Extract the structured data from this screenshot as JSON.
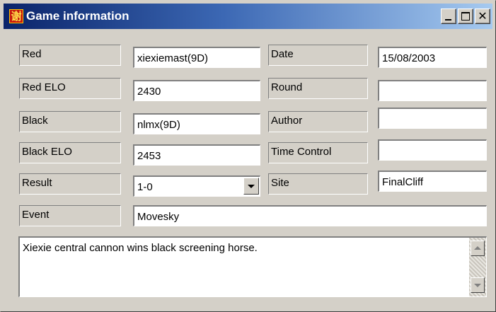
{
  "window": {
    "title": "Game information",
    "icon_char": "谢",
    "icon": "app-icon",
    "controls": [
      "minimize-icon",
      "maximize-icon",
      "close-icon"
    ],
    "close_glyph": "✕",
    "colors": {
      "titlebar_start": "#0a246a",
      "titlebar_end": "#a6caf0",
      "face": "#d4d0c8",
      "icon_bg": "#c8180f"
    }
  },
  "fields": {
    "red": {
      "label": "Red",
      "value": "xiexiemast(9D)"
    },
    "red_elo": {
      "label": "Red ELO",
      "value": "2430"
    },
    "black": {
      "label": "Black",
      "value": "nlmx(9D)"
    },
    "black_elo": {
      "label": "Black ELO",
      "value": "2453"
    },
    "result": {
      "label": "Result",
      "value": "1-0"
    },
    "event": {
      "label": "Event",
      "value": "Movesky"
    },
    "date": {
      "label": "Date",
      "value": "15/08/2003"
    },
    "round": {
      "label": "Round",
      "value": ""
    },
    "author": {
      "label": "Author",
      "value": ""
    },
    "time_control": {
      "label": "Time Control",
      "value": ""
    },
    "site": {
      "label": "Site",
      "value": "FinalCliff"
    }
  },
  "comment": "Xiexie central cannon wins black screening horse."
}
